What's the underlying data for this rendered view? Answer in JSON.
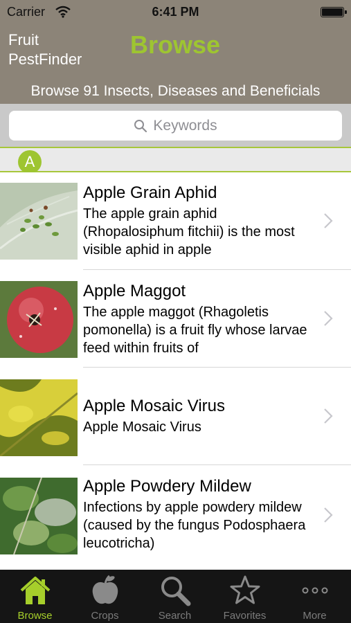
{
  "status_bar": {
    "carrier": "Carrier",
    "time": "6:41 PM"
  },
  "header": {
    "app_title": "Fruit PestFinder",
    "page_title": "Browse",
    "subtitle": "Browse 91 Insects, Diseases and Beneficials"
  },
  "search": {
    "placeholder": "Keywords"
  },
  "section": {
    "letter": "A"
  },
  "items": [
    {
      "title": "Apple Grain Aphid",
      "description": "The apple grain aphid (Rhopalosiphum fitchii) is the most visible aphid in apple"
    },
    {
      "title": "Apple Maggot",
      "description": "The apple maggot (Rhagoletis pomonella) is a fruit fly whose larvae feed within fruits of"
    },
    {
      "title": "Apple Mosaic Virus",
      "description": "Apple Mosaic Virus"
    },
    {
      "title": "Apple Powdery Mildew",
      "description": "Infections by apple powdery mildew (caused by the fungus Podosphaera leucotricha)"
    }
  ],
  "tabs": [
    {
      "label": "Browse",
      "icon": "home-icon",
      "active": true
    },
    {
      "label": "Crops",
      "icon": "apple-icon",
      "active": false
    },
    {
      "label": "Search",
      "icon": "magnifier-icon",
      "active": false
    },
    {
      "label": "Favorites",
      "icon": "star-icon",
      "active": false
    },
    {
      "label": "More",
      "icon": "more-dots-icon",
      "active": false
    }
  ],
  "colors": {
    "header_bg": "#8c8478",
    "accent_green": "#9ec531",
    "tabbar_bg": "#151515",
    "tab_inactive": "#7c7c7c"
  }
}
